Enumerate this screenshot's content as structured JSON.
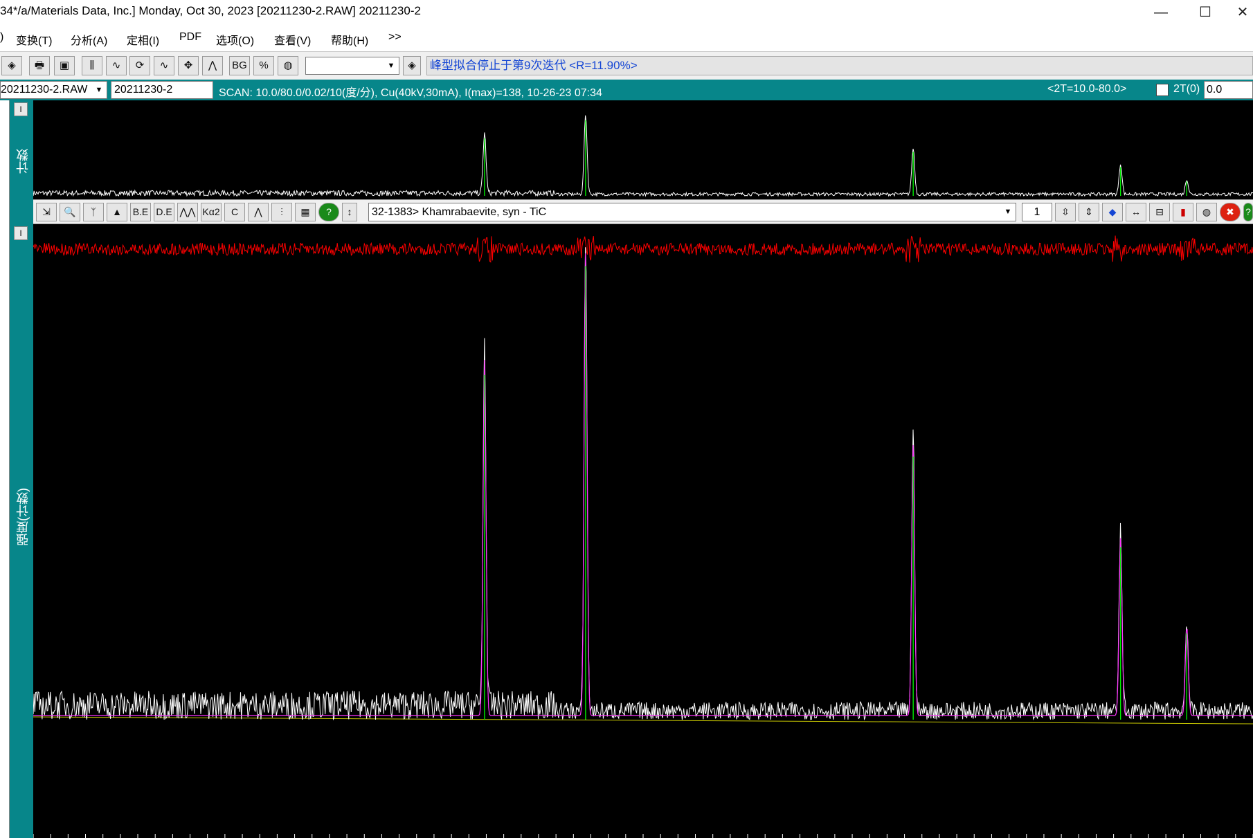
{
  "window": {
    "title": "34*/a/Materials Data, Inc.] Monday, Oct 30, 2023 [20211230-2.RAW] 20211230-2",
    "minimize": "—",
    "maximize": "☐",
    "close": "✕"
  },
  "menu": {
    "items": [
      {
        "label": ")"
      },
      {
        "label": "变换(T)"
      },
      {
        "label": "分析(A)"
      },
      {
        "label": "定相(I)"
      },
      {
        "label": "PDF"
      },
      {
        "label": "选项(O)"
      },
      {
        "label": "查看(V)"
      },
      {
        "label": "帮助(H)"
      },
      {
        "label": ">>"
      }
    ]
  },
  "toolbar": {
    "combo_value": "",
    "fit_status": "峰型拟合停止于第9次迭代 <R=11.90%>",
    "icons": [
      "eraser-icon",
      "print-icon",
      "save-icon",
      "bar-peaks-icon",
      "spectrum-icon",
      "rotate-icon",
      "smooth-icon",
      "shift-icon",
      "peaks-icon",
      "background-icon",
      "percent-icon",
      "globe-icon"
    ],
    "glyphs": [
      "◈",
      "🖶",
      "▣",
      "⫼",
      "∿",
      "⟳",
      "∿",
      "✥",
      "⋀",
      "BG",
      "%",
      "◍"
    ]
  },
  "scan": {
    "file": "20211230-2.RAW",
    "sample": "20211230-2",
    "info": "SCAN: 10.0/80.0/0.02/10(度/分), Cu(40kV,30mA), I(max)=138, 10-26-23 07:34",
    "range": "<2T=10.0-80.0>",
    "two_theta_label": "2T(0)",
    "two_theta_value": "0.0"
  },
  "left_panel": {
    "overview_axis_label": "计数",
    "main_axis_label": "强度(计数)",
    "collapse_glyph": "ǀ"
  },
  "phase_toolbar": {
    "phase": "32-1383> Khamrabaevite, syn - TiC",
    "number": "1",
    "left_glyphs": [
      "⇲",
      "🔍",
      "ᛉ",
      "▲",
      "B.E",
      "D.E",
      "⋀⋀",
      "Kα2",
      "C",
      "⋀",
      "⫶",
      "▦",
      "?",
      "↕"
    ],
    "right_glyphs": [
      "⇳",
      "⇕",
      "◆",
      "↔",
      "⊟",
      "▮",
      "◍",
      "✖",
      "?"
    ]
  },
  "colors": {
    "teal": "#07868a",
    "raw_pattern": "#ffffff",
    "difference": "#ff0000",
    "fit_profile": "#ff33ff",
    "reference_lines": "#00ff00",
    "background_line": "#c8c800"
  },
  "plot": {
    "x_range": [
      10.0,
      80.0
    ],
    "peaks": [
      {
        "two_theta": 35.9,
        "intensity": 0.76
      },
      {
        "two_theta": 41.7,
        "intensity": 1.0
      },
      {
        "two_theta": 60.5,
        "intensity": 0.58
      },
      {
        "two_theta": 72.4,
        "intensity": 0.38
      },
      {
        "two_theta": 76.2,
        "intensity": 0.19
      }
    ]
  }
}
